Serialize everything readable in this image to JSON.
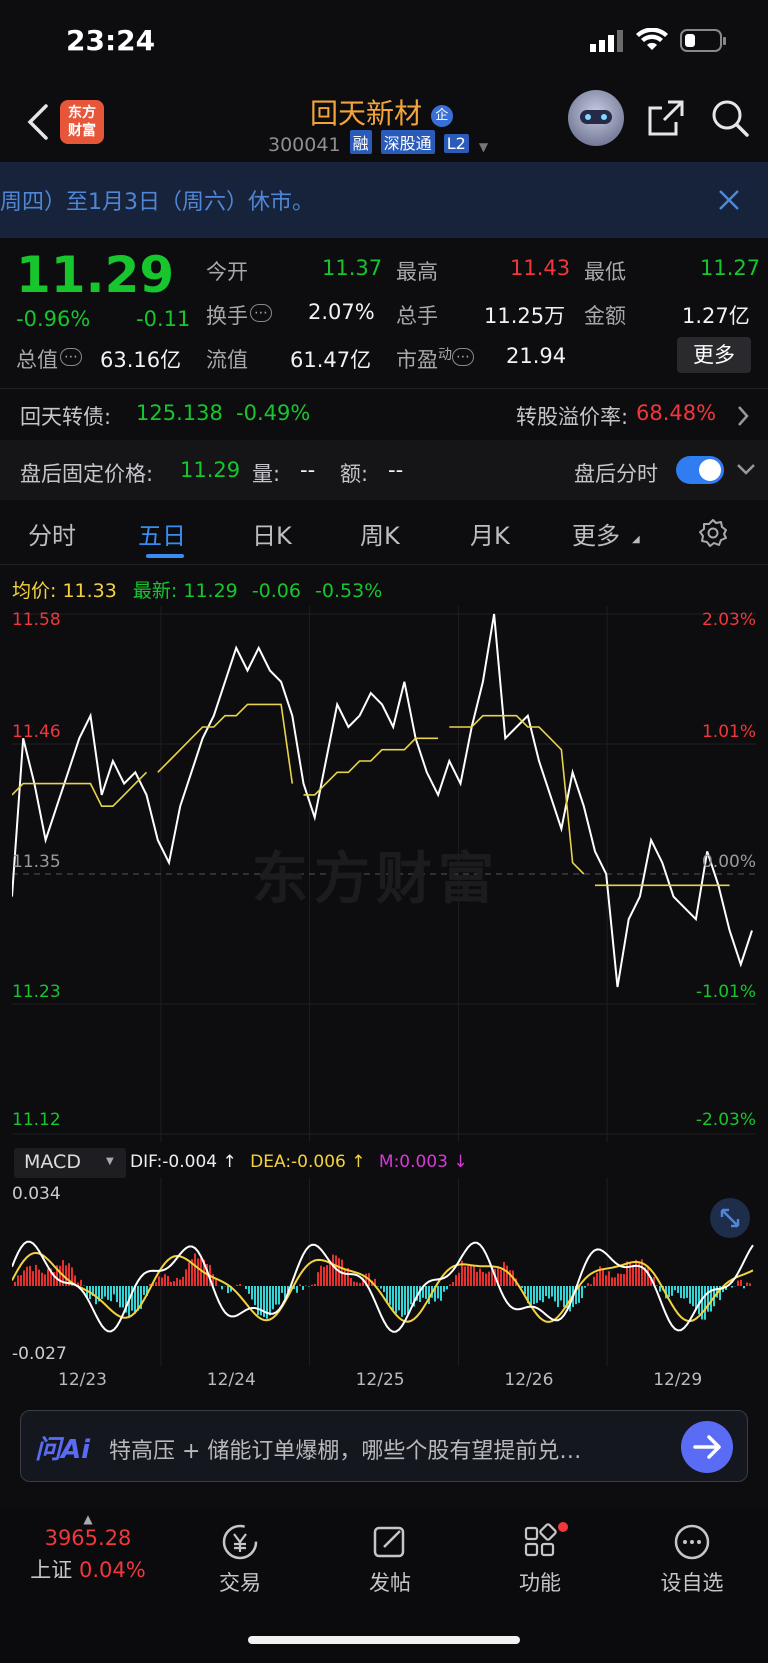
{
  "status_bar": {
    "time": "23:24"
  },
  "header": {
    "logo_text_1": "东方",
    "logo_text_2": "财富",
    "stock_name": "回天新材",
    "badge": "企",
    "code": "300041",
    "tags": [
      "融",
      "深股通",
      "L2"
    ]
  },
  "notice": {
    "text": "周四）至1月3日（周六）休市。"
  },
  "quote": {
    "price": "11.29",
    "change_pct": "-0.96%",
    "change": "-0.11",
    "fields": {
      "open_label": "今开",
      "open": "11.37",
      "high_label": "最高",
      "high": "11.43",
      "low_label": "最低",
      "low": "11.27",
      "turnover_label": "换手",
      "turnover": "2.07%",
      "volume_label": "总手",
      "volume": "11.25万",
      "amount_label": "金额",
      "amount": "1.27亿",
      "mktcap_label": "总值",
      "mktcap": "63.16亿",
      "float_label": "流值",
      "float": "61.47亿",
      "pe_label": "市盈",
      "pe_sup": "动",
      "pe": "21.94"
    },
    "more_button": "更多"
  },
  "bond": {
    "name": "回天转债:",
    "price": "125.138",
    "change": "-0.49%",
    "premium_label": "转股溢价率:",
    "premium": "68.48%"
  },
  "after_hours": {
    "price_label": "盘后固定价格:",
    "price": "11.29",
    "volume_label": "量:",
    "volume": "--",
    "amount_label": "额:",
    "amount": "--",
    "toggle_label": "盘后分时",
    "toggle_on": true
  },
  "tabs": [
    "分时",
    "五日",
    "日K",
    "周K",
    "月K",
    "更多"
  ],
  "active_tab": "五日",
  "chart_info": {
    "avg_label": "均价:",
    "avg": "11.33",
    "latest_label": "最新:",
    "latest": "11.29",
    "latest_change": "-0.06",
    "latest_pct": "-0.53%",
    "watermark": "东方财富"
  },
  "chart_data": {
    "type": "line",
    "y_left_ticks": [
      "11.58",
      "11.46",
      "11.35",
      "11.23",
      "11.12"
    ],
    "y_right_ticks": [
      "2.03%",
      "1.01%",
      "0.00%",
      "-1.01%",
      "-2.03%"
    ],
    "ylim": [
      11.12,
      11.58
    ],
    "x_labels": [
      "12/23",
      "12/24",
      "12/25",
      "12/26",
      "12/29"
    ],
    "prev_close": 11.35,
    "series": [
      {
        "name": "price",
        "color": "#ffffff",
        "values": [
          11.33,
          11.47,
          11.43,
          11.38,
          11.41,
          11.44,
          11.47,
          11.49,
          11.42,
          11.45,
          11.43,
          11.44,
          11.42,
          11.38,
          11.36,
          11.41,
          11.44,
          11.47,
          11.49,
          11.52,
          11.55,
          11.53,
          11.55,
          11.53,
          11.52,
          11.49,
          11.43,
          11.4,
          11.45,
          11.5,
          11.48,
          11.49,
          11.51,
          11.5,
          11.48,
          11.52,
          11.47,
          11.44,
          11.42,
          11.45,
          11.43,
          11.48,
          11.52,
          11.58,
          11.47,
          11.48,
          11.49,
          11.45,
          11.42,
          11.39,
          11.44,
          11.41,
          11.37,
          11.35,
          11.25,
          11.31,
          11.33,
          11.38,
          11.36,
          11.33,
          11.32,
          11.31,
          11.37,
          11.34,
          11.3,
          11.27,
          11.3
        ]
      },
      {
        "name": "avg",
        "color": "#e8d44a",
        "values": [
          11.42,
          11.43,
          11.43,
          11.43,
          11.43,
          11.43,
          11.43,
          11.43,
          11.41,
          11.41,
          11.42,
          11.43,
          11.44,
          11.44,
          11.45,
          11.46,
          11.47,
          11.48,
          11.48,
          11.49,
          11.49,
          11.5,
          11.5,
          11.5,
          11.5,
          11.43,
          11.42,
          11.42,
          11.43,
          11.44,
          11.44,
          11.45,
          11.45,
          11.46,
          11.46,
          11.46,
          11.47,
          11.47,
          11.47,
          11.48,
          11.48,
          11.48,
          11.49,
          11.49,
          11.49,
          11.49,
          11.48,
          11.48,
          11.47,
          11.46,
          11.36,
          11.35,
          11.34,
          11.34,
          11.34,
          11.34,
          11.34,
          11.34,
          11.34,
          11.34,
          11.34,
          11.34,
          11.34,
          11.34,
          11.34,
          11.34,
          11.33
        ]
      }
    ]
  },
  "macd": {
    "selector": "MACD",
    "dif": "DIF:-0.004 ↑",
    "dea": "DEA:-0.006 ↑",
    "m": "M:0.003 ↓",
    "top_label": "0.034",
    "bottom_label": "-0.027"
  },
  "ai": {
    "logo": "问Ai",
    "prompt": "特高压 + 储能订单爆棚，哪些个股有望提前兑…"
  },
  "nav": {
    "index_value": "3965.28",
    "index_name": "上证",
    "index_pct": "0.04%",
    "items": [
      "交易",
      "发帖",
      "功能",
      "设自选"
    ]
  }
}
